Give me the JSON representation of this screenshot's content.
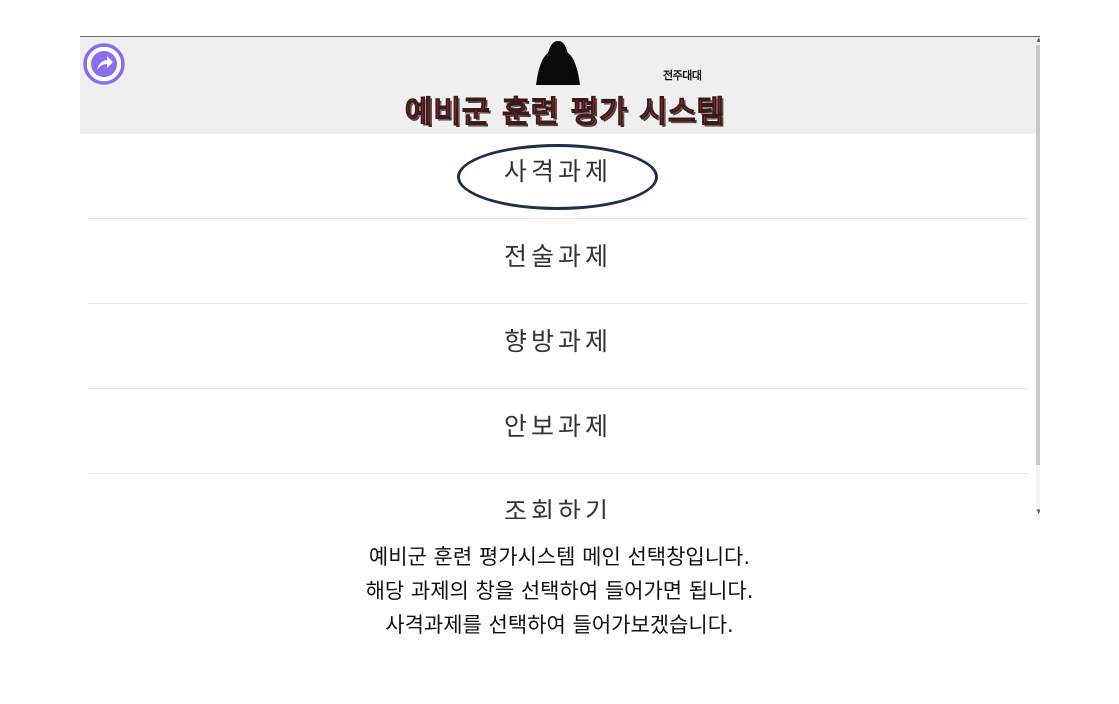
{
  "header": {
    "unit_name": "전주대대",
    "system_title": "예비군 훈련 평가 시스템",
    "back_icon": "circle-arrow-icon",
    "mascot_icon": "mascot-silhouette-icon",
    "accent_color": "#8a6cf0",
    "title_color": "#e8324a"
  },
  "menu": {
    "items": [
      {
        "label": "사격과제"
      },
      {
        "label": "전술과제"
      },
      {
        "label": "향방과제"
      },
      {
        "label": "안보과제"
      },
      {
        "label": "조회하기"
      }
    ],
    "highlighted_index": 0
  },
  "caption": {
    "line1": "예비군 훈련 평가시스템 메인 선택창입니다.",
    "line2": "해당 과제의 창을 선택하여 들어가면 됩니다.",
    "line3": "사격과제를 선택하여 들어가보겠습니다."
  }
}
